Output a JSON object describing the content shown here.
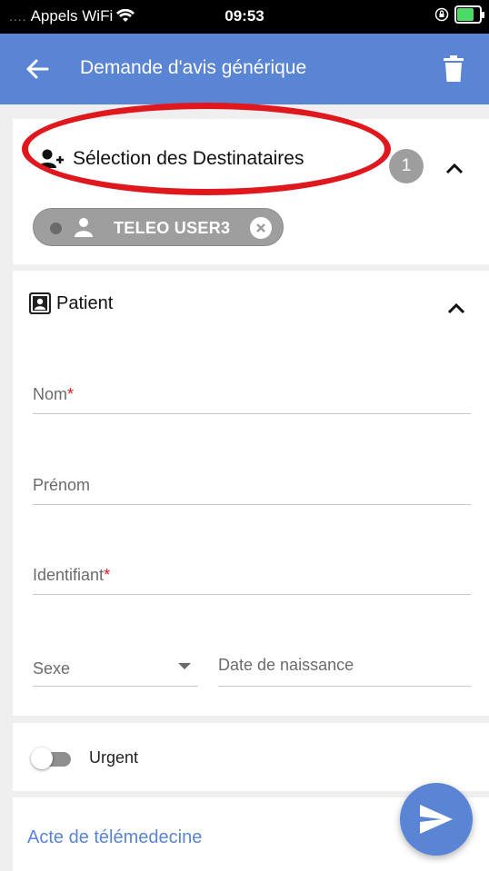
{
  "status_bar": {
    "carrier": "Appels WiFi",
    "time": "09:53"
  },
  "app_bar": {
    "title": "Demande d'avis générique"
  },
  "destinataires": {
    "title": "Sélection des Destinataires",
    "count": "1",
    "chips": [
      {
        "label": "TELEO USER3"
      }
    ]
  },
  "patient": {
    "title": "Patient",
    "fields": {
      "nom": {
        "label": "Nom",
        "required_mark": "*"
      },
      "prenom": {
        "label": "Prénom"
      },
      "identifiant": {
        "label": "Identifiant",
        "required_mark": "*"
      },
      "sexe": {
        "label": "Sexe"
      },
      "date_naissance": {
        "label": "Date de naissance"
      }
    }
  },
  "urgent": {
    "label": "Urgent",
    "enabled": false
  },
  "acte": {
    "label": "Acte de télémedecine"
  },
  "colors": {
    "primary": "#5a84d4",
    "highlight": "#e0171c",
    "required": "#e0171c",
    "badge": "#9e9e9e"
  },
  "icons": {
    "back": "arrow-back-icon",
    "trash": "trash-icon",
    "add_user": "add-user-icon",
    "patient": "patient-card-icon",
    "send": "send-icon"
  }
}
